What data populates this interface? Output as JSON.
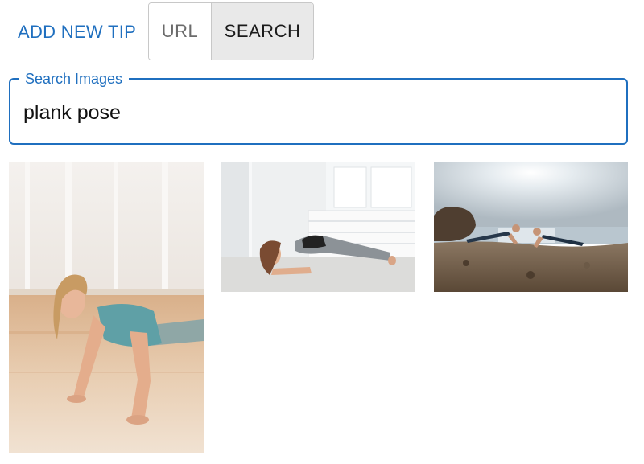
{
  "toolbar": {
    "add_tip_label": "ADD NEW TIP",
    "mode_options": [
      "URL",
      "SEARCH"
    ],
    "selected_mode": "SEARCH"
  },
  "search": {
    "label": "Search Images",
    "value": "plank pose"
  },
  "colors": {
    "accent": "#1f6fbf",
    "selected_toggle_bg": "#e9e9e9"
  },
  "results": [
    {
      "description": "woman in teal top doing push-up plank on wooden floor"
    },
    {
      "description": "woman doing forearm plank in bright white studio"
    },
    {
      "description": "two people planking facing each other on rocky beach"
    }
  ]
}
